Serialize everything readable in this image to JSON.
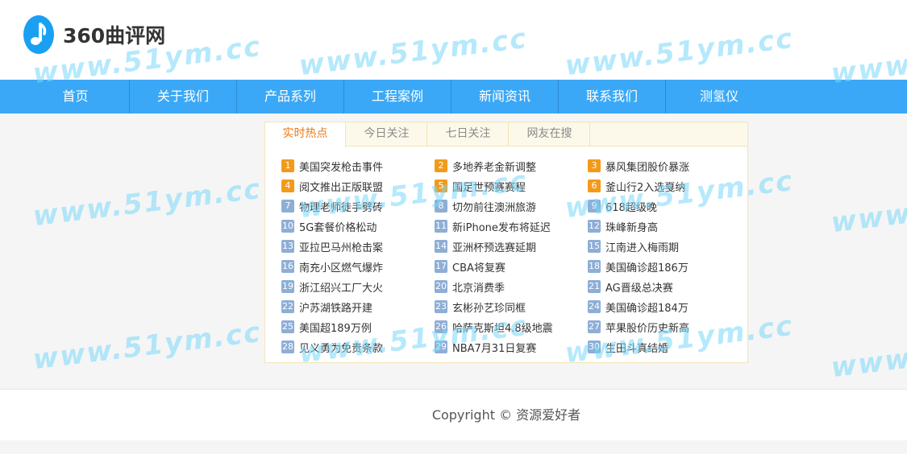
{
  "site": {
    "name": "360曲评网"
  },
  "nav": [
    "首页",
    "关于我们",
    "产品系列",
    "工程案例",
    "新闻资讯",
    "联系我们",
    "测氢仪"
  ],
  "tabs": [
    {
      "label": "实时热点",
      "active": true
    },
    {
      "label": "今日关注",
      "active": false
    },
    {
      "label": "七日关注",
      "active": false
    },
    {
      "label": "网友在搜",
      "active": false
    }
  ],
  "hot_list": [
    {
      "num": "1",
      "text": "美国突发枪击事件"
    },
    {
      "num": "2",
      "text": "多地养老金新调整"
    },
    {
      "num": "3",
      "text": "暴风集团股价暴涨"
    },
    {
      "num": "4",
      "text": "阅文推出正版联盟"
    },
    {
      "num": "5",
      "text": "国足世预赛赛程"
    },
    {
      "num": "6",
      "text": "釜山行2入选戛纳"
    },
    {
      "num": "7",
      "text": "物理老师徒手劈砖"
    },
    {
      "num": "8",
      "text": "切勿前往澳洲旅游"
    },
    {
      "num": "9",
      "text": "618超级晚"
    },
    {
      "num": "10",
      "text": "5G套餐价格松动"
    },
    {
      "num": "11",
      "text": "新iPhone发布将延迟"
    },
    {
      "num": "12",
      "text": "珠峰新身高"
    },
    {
      "num": "13",
      "text": "亚拉巴马州枪击案"
    },
    {
      "num": "14",
      "text": "亚洲杯预选赛延期"
    },
    {
      "num": "15",
      "text": "江南进入梅雨期"
    },
    {
      "num": "16",
      "text": "南充小区燃气爆炸"
    },
    {
      "num": "17",
      "text": "CBA将复赛"
    },
    {
      "num": "18",
      "text": "美国确诊超186万"
    },
    {
      "num": "19",
      "text": "浙江绍兴工厂大火"
    },
    {
      "num": "20",
      "text": "北京消费季"
    },
    {
      "num": "21",
      "text": "AG晋级总决赛"
    },
    {
      "num": "22",
      "text": "沪苏湖铁路开建"
    },
    {
      "num": "23",
      "text": "玄彬孙艺珍同框"
    },
    {
      "num": "24",
      "text": "美国确诊超184万"
    },
    {
      "num": "25",
      "text": "美国超189万例"
    },
    {
      "num": "26",
      "text": "哈萨克斯坦4.8级地震"
    },
    {
      "num": "27",
      "text": "苹果股价历史新高"
    },
    {
      "num": "28",
      "text": "见义勇为免责条款"
    },
    {
      "num": "29",
      "text": "NBA7月31日复赛"
    },
    {
      "num": "30",
      "text": "生田斗真结婚"
    }
  ],
  "footer": {
    "copyright": "Copyright © 资源爱好者"
  },
  "watermark": "www.51ym.cc",
  "colors": {
    "nav_bg": "#3aa8f6",
    "hot_badge": "#f39a1a",
    "normal_badge": "#8eaed6",
    "active_tab": "#e87a1a"
  }
}
